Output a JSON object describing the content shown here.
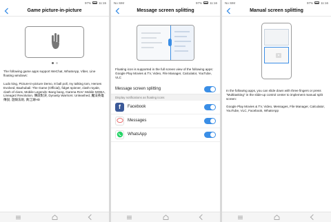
{
  "status_bar": {
    "p1": {
      "left": "",
      "right_time": "11:15",
      "battery": "97%"
    },
    "p2": {
      "left": "No SIM",
      "right_time": "11:16",
      "battery": "97%"
    },
    "p3": {
      "left": "No SIM",
      "right_time": "11:16",
      "battery": "97%"
    }
  },
  "panel1": {
    "title": "Game picture-in-picture",
    "intro": "The following game apps support WeChat, WhatsApp, Viber, Line floating windows:",
    "games": "Ludo king, Picture-in-picture Demo, 8 ball poll, my talking tom, Heroes Evolved, Baahubali: The Game (Official), fidget spinner, clash royale, clash of clans, Mobile Legends: Bang bang, Garena RoV: Mobile MOBA, Lineage2 Revolution, 傳說對決, Dynasty Warriors: Unleashed, 魔法英雄傳說, 遊騎法則, 真江湖HD"
  },
  "panel2": {
    "title": "Message screen splitting",
    "desc": "Floating icon is supported in the full screen view of the following apps: Google Play Movies & TV, Video, File Manager, Calculator, YouTube, VLC",
    "main_toggle_label": "Message screen splitting",
    "hint": "Display notifications as floating icons",
    "apps": [
      {
        "name": "Facebook",
        "icon": "facebook-icon"
      },
      {
        "name": "Messages",
        "icon": "messages-icon"
      },
      {
        "name": "WhatsApp",
        "icon": "whatsapp-icon"
      }
    ]
  },
  "panel3": {
    "title": "Manual screen splitting",
    "desc1": "In the following apps, you can slide down with three fingers or press \"Multitasking\" in the slide-up control center to implement manual split screen:",
    "desc2": "Google Play Movies & TV, Video, Messages, File Manager, Calculator, YouTube, VLC, Facebook, WhatsApp"
  },
  "colors": {
    "accent": "#3a8ee6",
    "facebook": "#3b5998",
    "whatsapp": "#25d366"
  }
}
